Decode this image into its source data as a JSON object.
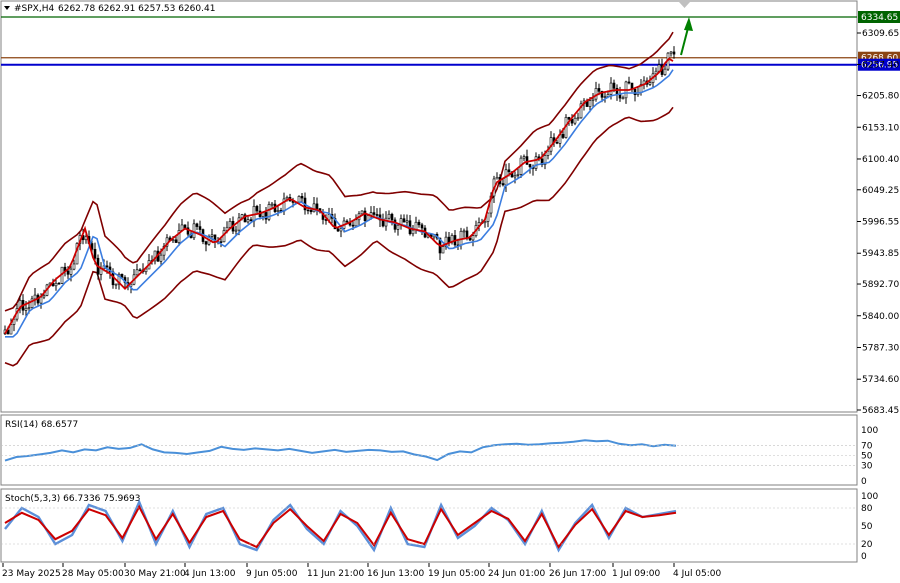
{
  "header": {
    "symbol": "#SPX,H4",
    "ohlc": "6262.78 6262.91 6257.53 6260.41"
  },
  "rsi_label": "RSI(14) 68.6577",
  "stoch_label": "Stoch(5,3,3) 66.7336 75.9693",
  "colors": {
    "up_candle": "#000000",
    "ma_fast": "#cc0000",
    "ma_slow": "#3b7de0",
    "bollinger": "#800000",
    "resistance_line": "#006400",
    "price_line": "#8b4513",
    "support_line": "#0000cd",
    "arrow": "#008000",
    "rsi": "#4a90d9",
    "stoch_main": "#5b8fd9",
    "stoch_signal": "#cc0000"
  },
  "chart_data": {
    "type": "candlestick",
    "price_axis": {
      "min": 5683.45,
      "max": 6309.65,
      "ticks": [
        "6309.65",
        "6257.40",
        "6205.80",
        "6153.10",
        "6100.40",
        "6049.25",
        "5996.55",
        "5943.85",
        "5892.70",
        "5840.00",
        "5787.30",
        "5734.60",
        "5683.45"
      ]
    },
    "levels": [
      {
        "label": "6334.65",
        "value": 6334.65,
        "color": "#006400"
      },
      {
        "label": "6268.60",
        "value": 6268.6,
        "color": "#8b4513"
      },
      {
        "label": "6256.95",
        "value": 6256.95,
        "color": "#0000cd"
      }
    ],
    "x_labels": [
      "23 May 2025",
      "28 May 05:00",
      "30 May 21:00",
      "4 Jun 13:00",
      "9 Jun 05:00",
      "11 Jun 21:00",
      "16 Jun 13:00",
      "19 Jun 05:00",
      "24 Jun 01:00",
      "26 Jun 17:00",
      "1 Jul 09:00",
      "4 Jul 05:00"
    ],
    "rsi": {
      "range": [
        0,
        100
      ],
      "ticks": [
        "100",
        "70",
        "50",
        "30",
        "0"
      ],
      "values": [
        40,
        47,
        49,
        52,
        55,
        60,
        56,
        62,
        60,
        66,
        63,
        65,
        72,
        62,
        56,
        55,
        53,
        56,
        59,
        67,
        63,
        61,
        64,
        62,
        60,
        63,
        59,
        55,
        58,
        61,
        57,
        59,
        61,
        60,
        57,
        58,
        52,
        48,
        41,
        53,
        58,
        56,
        66,
        70,
        72,
        73,
        71,
        72,
        74,
        75,
        77,
        80,
        78,
        79,
        73,
        70,
        72,
        68,
        71,
        69
      ]
    },
    "stoch": {
      "range": [
        0,
        100
      ],
      "ticks": [
        "100",
        "80",
        "50",
        "20",
        "0"
      ],
      "main": [
        45,
        80,
        65,
        20,
        35,
        85,
        75,
        25,
        90,
        20,
        75,
        15,
        70,
        80,
        20,
        10,
        60,
        85,
        45,
        20,
        75,
        50,
        10,
        80,
        20,
        15,
        85,
        30,
        50,
        80,
        60,
        20,
        75,
        10,
        55,
        85,
        30,
        80,
        65,
        70,
        75
      ],
      "signal": [
        55,
        72,
        60,
        28,
        42,
        78,
        68,
        30,
        82,
        28,
        70,
        22,
        65,
        75,
        28,
        15,
        55,
        78,
        50,
        25,
        70,
        55,
        18,
        72,
        28,
        20,
        78,
        35,
        55,
        75,
        62,
        25,
        70,
        15,
        52,
        78,
        35,
        75,
        65,
        68,
        72
      ]
    }
  }
}
